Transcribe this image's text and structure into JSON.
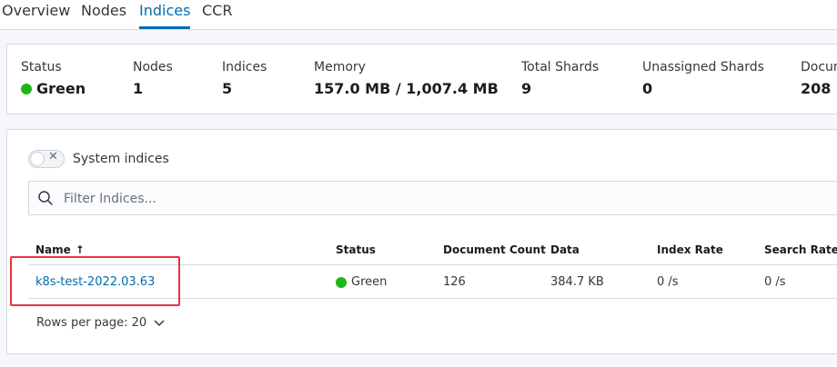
{
  "tabs": [
    {
      "label": "Overview"
    },
    {
      "label": "Nodes"
    },
    {
      "label": "Indices"
    },
    {
      "label": "CCR"
    }
  ],
  "stats": {
    "status_label": "Status",
    "status_value": "Green",
    "nodes_label": "Nodes",
    "nodes_value": "1",
    "indices_label": "Indices",
    "indices_value": "5",
    "memory_label": "Memory",
    "memory_value": "157.0 MB / 1,007.4 MB",
    "total_shards_label": "Total Shards",
    "total_shards_value": "9",
    "unassigned_label": "Unassigned Shards",
    "unassigned_value": "0",
    "documents_label": "Documents",
    "documents_value": "208"
  },
  "toolbar": {
    "system_indices_label": "System indices",
    "search_placeholder": "Filter Indices..."
  },
  "table": {
    "columns": [
      "Name",
      "Status",
      "Document Count",
      "Data",
      "Index Rate",
      "Search Rate"
    ],
    "sort_indicator": "↑",
    "rows": [
      {
        "name": "k8s-test-2022.03.63",
        "status": "Green",
        "doc_count": "126",
        "data": "384.7 KB",
        "index_rate": "0 /s",
        "search_rate": "0 /s"
      }
    ]
  },
  "pagination": {
    "rows_per_page": "Rows per page: 20"
  },
  "colors": {
    "accent": "#006bb4",
    "status_green": "#1fb51a",
    "highlight_red": "#e8323c"
  }
}
